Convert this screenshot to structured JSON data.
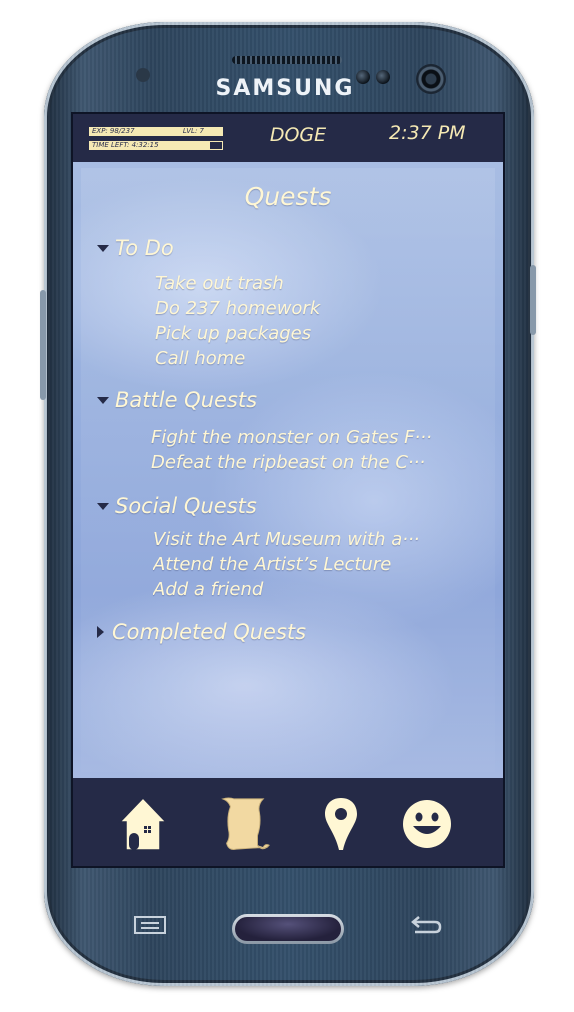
{
  "device": {
    "brand": "SAMSUNG"
  },
  "status_bar": {
    "exp_label": "EXP: 98/237",
    "level_label": "LVL: 7",
    "time_left_label": "TIME LEFT: 4:32:15",
    "app_name": "DOGE",
    "clock": "2:37 PM"
  },
  "page": {
    "title": "Quests"
  },
  "sections": [
    {
      "label": "To Do",
      "expanded": true,
      "items": [
        "Take out trash",
        "Do 237 homework",
        "Pick up packages",
        "Call home"
      ]
    },
    {
      "label": "Battle Quests",
      "expanded": true,
      "items": [
        "Fight the monster on Gates F···",
        "Defeat the ripbeast on the C···"
      ]
    },
    {
      "label": "Social Quests",
      "expanded": true,
      "items": [
        "Visit the Art Museum with a···",
        "Attend the Artist’s Lecture",
        "Add a friend"
      ]
    },
    {
      "label": "Completed Quests",
      "expanded": false,
      "items": []
    }
  ],
  "nav": [
    {
      "name": "home-icon"
    },
    {
      "name": "scroll-icon"
    },
    {
      "name": "map-pin-icon"
    },
    {
      "name": "smiley-icon"
    }
  ],
  "colors": {
    "screen_dark": "#252a47",
    "text_cream": "#fff7d4",
    "accent_cream": "#f5e9b4",
    "scroll_tan": "#f2d9a2"
  }
}
